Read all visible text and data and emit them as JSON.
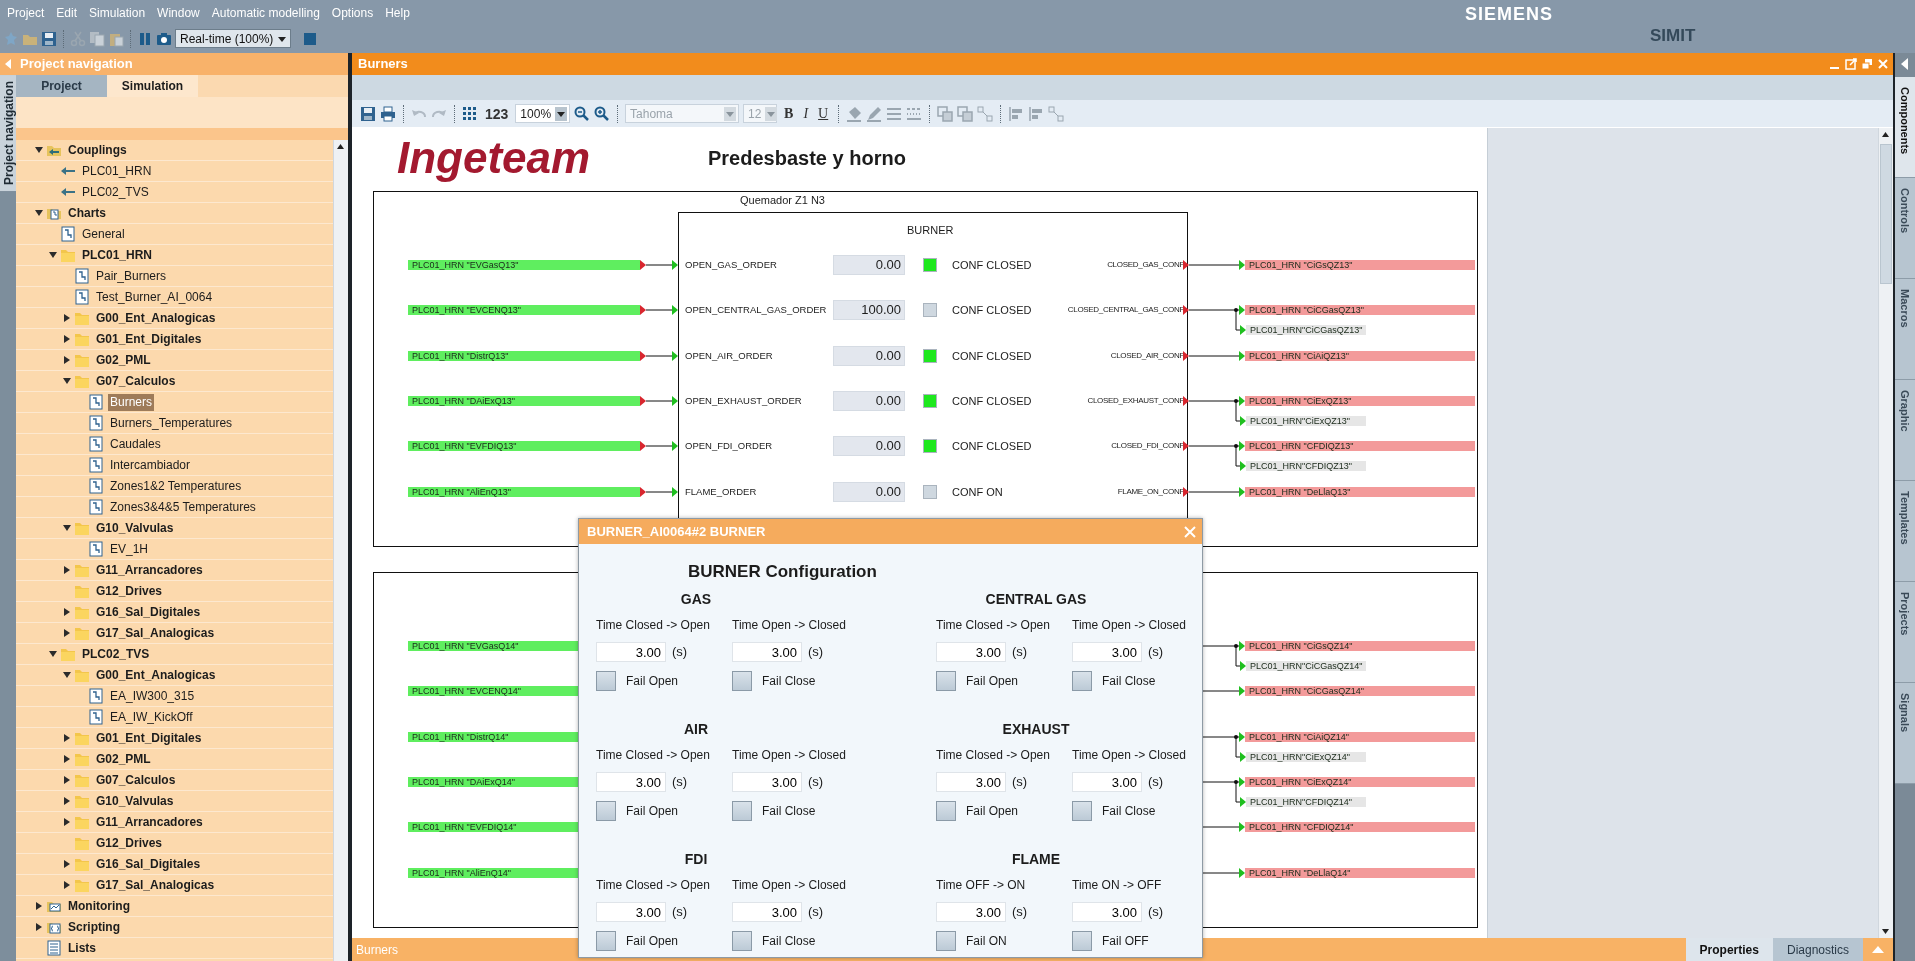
{
  "menu_bar": [
    "Project",
    "Edit",
    "Simulation",
    "Window",
    "Automatic modelling",
    "Options",
    "Help"
  ],
  "toolbar": {
    "speed": "Real-time (100%)"
  },
  "brand": {
    "vendor": "SIEMENS",
    "product": "SIMIT"
  },
  "navigation": {
    "title": "Project navigation",
    "side_label": "Project navigation",
    "tabs": [
      {
        "label": "Project",
        "selected": false
      },
      {
        "label": "Simulation",
        "selected": true
      }
    ],
    "tree": [
      {
        "label": "Couplings",
        "kind": "couplings",
        "expanded": true,
        "selected": false,
        "children": [
          {
            "label": "PLC01_HRN",
            "kind": "coupling",
            "selected": false
          },
          {
            "label": "PLC02_TVS",
            "kind": "coupling",
            "selected": false
          }
        ]
      },
      {
        "label": "Charts",
        "kind": "charts",
        "expanded": true,
        "selected": false,
        "children": [
          {
            "label": "General",
            "kind": "chart",
            "selected": false
          },
          {
            "label": "PLC01_HRN",
            "kind": "folder",
            "expanded": true,
            "selected": false,
            "children": [
              {
                "label": "Pair_Burners",
                "kind": "chart",
                "selected": false
              },
              {
                "label": "Test_Burner_AI_0064",
                "kind": "chart",
                "selected": false
              },
              {
                "label": "G00_Ent_Analogicas",
                "kind": "folder",
                "expanded": false,
                "selected": false
              },
              {
                "label": "G01_Ent_Digitales",
                "kind": "folder",
                "expanded": false,
                "selected": false
              },
              {
                "label": "G02_PML",
                "kind": "folder",
                "expanded": false,
                "selected": false
              },
              {
                "label": "G07_Calculos",
                "kind": "folder",
                "expanded": true,
                "selected": false,
                "children": [
                  {
                    "label": "Burners",
                    "kind": "chart",
                    "selected": true
                  },
                  {
                    "label": "Burners_Temperatures",
                    "kind": "chart",
                    "selected": false
                  },
                  {
                    "label": "Caudales",
                    "kind": "chart",
                    "selected": false
                  },
                  {
                    "label": "Intercambiador",
                    "kind": "chart",
                    "selected": false
                  },
                  {
                    "label": "Zones1&2 Temperatures",
                    "kind": "chart",
                    "selected": false
                  },
                  {
                    "label": "Zones3&4&5 Temperatures",
                    "kind": "chart",
                    "selected": false
                  }
                ]
              },
              {
                "label": "G10_Valvulas",
                "kind": "folder",
                "expanded": true,
                "selected": false,
                "children": [
                  {
                    "label": "EV_1H",
                    "kind": "chart",
                    "selected": false
                  }
                ]
              },
              {
                "label": "G11_Arrancadores",
                "kind": "folder",
                "expanded": false,
                "selected": false
              },
              {
                "label": "G12_Drives",
                "kind": "folder",
                "selected": false
              },
              {
                "label": "G16_Sal_Digitales",
                "kind": "folder",
                "expanded": false,
                "selected": false
              },
              {
                "label": "G17_Sal_Analogicas",
                "kind": "folder",
                "expanded": false,
                "selected": false
              }
            ]
          },
          {
            "label": "PLC02_TVS",
            "kind": "folder",
            "expanded": true,
            "selected": false,
            "children": [
              {
                "label": "G00_Ent_Analogicas",
                "kind": "folder",
                "expanded": true,
                "selected": false,
                "children": [
                  {
                    "label": "EA_IW300_315",
                    "kind": "chart",
                    "selected": false
                  },
                  {
                    "label": "EA_IW_KickOff",
                    "kind": "chart",
                    "selected": false
                  }
                ]
              },
              {
                "label": "G01_Ent_Digitales",
                "kind": "folder",
                "expanded": false,
                "selected": false
              },
              {
                "label": "G02_PML",
                "kind": "folder",
                "expanded": false,
                "selected": false
              },
              {
                "label": "G07_Calculos",
                "kind": "folder",
                "expanded": false,
                "selected": false
              },
              {
                "label": "G10_Valvulas",
                "kind": "folder",
                "expanded": false,
                "selected": false
              },
              {
                "label": "G11_Arrancadores",
                "kind": "folder",
                "expanded": false,
                "selected": false
              },
              {
                "label": "G12_Drives",
                "kind": "folder",
                "selected": false
              },
              {
                "label": "G16_Sal_Digitales",
                "kind": "folder",
                "expanded": false,
                "selected": false
              },
              {
                "label": "G17_Sal_Analogicas",
                "kind": "folder",
                "expanded": false,
                "selected": false
              }
            ]
          }
        ]
      },
      {
        "label": "Monitoring",
        "kind": "monitoring",
        "expanded": false,
        "selected": false
      },
      {
        "label": "Scripting",
        "kind": "scripting",
        "expanded": false,
        "selected": false
      },
      {
        "label": "Lists",
        "kind": "lists",
        "selected": false
      }
    ]
  },
  "editor": {
    "title": "Burners",
    "toolbar": {
      "number_format": "123",
      "zoom": "100%",
      "font": {
        "value": "Tahoma",
        "disabled": true
      },
      "font_size": {
        "value": "12",
        "disabled": true
      },
      "styles": [
        {
          "label": "B",
          "kind": "bold"
        },
        {
          "label": "I",
          "kind": "italic"
        },
        {
          "label": "U",
          "kind": "underline"
        }
      ]
    },
    "chart": {
      "logo": "Ingeteam",
      "title": "Predesbaste y horno",
      "blocks": [
        {
          "group_label": "Quemador Z1 N3",
          "title": "BURNER",
          "rows": [
            {
              "input_signal": "PLC01_HRN \"EVGasQ13\"",
              "input_port": "OPEN_GAS_ORDER",
              "value": "0.00",
              "on": true,
              "status": "CONF CLOSED",
              "output_port": "CLOSED_GAS_CONF",
              "outputs": [
                {
                  "signal": "PLC01_HRN \"CiGsQZ13\"",
                  "kind": "primary"
                }
              ]
            },
            {
              "input_signal": "PLC01_HRN \"EVCENQ13\"",
              "input_port": "OPEN_CENTRAL_GAS_ORDER",
              "value": "100.00",
              "on": false,
              "status": "CONF CLOSED",
              "output_port": "CLOSED_CENTRAL_GAS_CONF",
              "outputs": [
                {
                  "signal": "PLC01_HRN \"CiCGasQZ13\"",
                  "kind": "primary"
                },
                {
                  "signal": "PLC01_HRN\"CiCGasQZ13\"",
                  "kind": "secondary"
                }
              ]
            },
            {
              "input_signal": "PLC01_HRN \"DistrQ13\"",
              "input_port": "OPEN_AIR_ORDER",
              "value": "0.00",
              "on": true,
              "status": "CONF CLOSED",
              "output_port": "CLOSED_AIR_CONF",
              "outputs": [
                {
                  "signal": "PLC01_HRN \"CiAiQZ13\"",
                  "kind": "primary"
                }
              ]
            },
            {
              "input_signal": "PLC01_HRN \"DAiExQ13\"",
              "input_port": "OPEN_EXHAUST_ORDER",
              "value": "0.00",
              "on": true,
              "status": "CONF CLOSED",
              "output_port": "CLOSED_EXHAUST_CONF",
              "outputs": [
                {
                  "signal": "PLC01_HRN \"CiExQZ13\"",
                  "kind": "primary"
                },
                {
                  "signal": "PLC01_HRN\"CiExQZ13\"",
                  "kind": "secondary"
                }
              ]
            },
            {
              "input_signal": "PLC01_HRN \"EVFDIQ13\"",
              "input_port": "OPEN_FDI_ORDER",
              "value": "0.00",
              "on": true,
              "status": "CONF CLOSED",
              "output_port": "CLOSED_FDI_CONF",
              "outputs": [
                {
                  "signal": "PLC01_HRN \"CFDIQZ13\"",
                  "kind": "primary"
                },
                {
                  "signal": "PLC01_HRN\"CFDIQZ13\"",
                  "kind": "secondary"
                }
              ]
            },
            {
              "input_signal": "PLC01_HRN \"AliEnQ13\"",
              "input_port": "FLAME_ORDER",
              "value": "0.00",
              "on": false,
              "status": "CONF ON",
              "output_port": "FLAME_ON_CONF",
              "outputs": [
                {
                  "signal": "PLC01_HRN \"DeLlaQ13\"",
                  "kind": "primary"
                }
              ]
            }
          ]
        },
        {
          "rows": [
            {
              "input_signal": "PLC01_HRN \"EVGasQ14\"",
              "outputs": [
                {
                  "signal": "PLC01_HRN \"CiGsQZ14\"",
                  "kind": "primary"
                },
                {
                  "signal": "PLC01_HRN\"CiCGasQZ14\"",
                  "kind": "secondary"
                }
              ]
            },
            {
              "input_signal": "PLC01_HRN \"EVCENQ14\"",
              "outputs": [
                {
                  "signal": "PLC01_HRN \"CiCGasQZ14\"",
                  "kind": "primary"
                }
              ]
            },
            {
              "input_signal": "PLC01_HRN \"DistrQ14\"",
              "outputs": [
                {
                  "signal": "PLC01_HRN \"CiAiQZ14\"",
                  "kind": "primary"
                },
                {
                  "signal": "PLC01_HRN\"CiExQZ14\"",
                  "kind": "secondary"
                }
              ]
            },
            {
              "input_signal": "PLC01_HRN \"DAiExQ14\"",
              "outputs": [
                {
                  "signal": "PLC01_HRN \"CiExQZ14\"",
                  "kind": "primary"
                },
                {
                  "signal": "PLC01_HRN\"CFDIQZ14\"",
                  "kind": "secondary"
                }
              ]
            },
            {
              "input_signal": "PLC01_HRN \"EVFDIQ14\"",
              "outputs": [
                {
                  "signal": "PLC01_HRN \"CFDIQZ14\"",
                  "kind": "primary"
                }
              ]
            },
            {
              "input_signal": "PLC01_HRN \"AliEnQ14\"",
              "outputs": [
                {
                  "signal": "PLC01_HRN \"DeLlaQ14\"",
                  "kind": "primary"
                }
              ]
            }
          ]
        }
      ]
    },
    "footer_label": "Burners",
    "bottom_tabs": [
      {
        "label": "Properties",
        "selected": true
      },
      {
        "label": "Diagnostics",
        "selected": false
      }
    ]
  },
  "side_tabs": [
    {
      "label": "Components",
      "selected": true
    },
    {
      "label": "Controls",
      "selected": false
    },
    {
      "label": "Macros",
      "selected": false
    },
    {
      "label": "Graphic",
      "selected": false
    },
    {
      "label": "Templates",
      "selected": false
    },
    {
      "label": "Projects",
      "selected": false
    },
    {
      "label": "Signals",
      "selected": false
    }
  ],
  "dialog": {
    "title": "BURNER_AI0064#2 BURNER",
    "heading": "BURNER Configuration",
    "sections": [
      {
        "title": "GAS",
        "timers": [
          {
            "label": "Time Closed -> Open",
            "value": "3.00",
            "unit": "(s)",
            "option": "Fail Open",
            "checked": false
          },
          {
            "label": "Time Open -> Closed",
            "value": "3.00",
            "unit": "(s)",
            "option": "Fail Close",
            "checked": false
          }
        ]
      },
      {
        "title": "CENTRAL GAS",
        "timers": [
          {
            "label": "Time Closed -> Open",
            "value": "3.00",
            "unit": "(s)",
            "option": "Fail Open",
            "checked": false
          },
          {
            "label": "Time Open -> Closed",
            "value": "3.00",
            "unit": "(s)",
            "option": "Fail Close",
            "checked": false
          }
        ]
      },
      {
        "title": "AIR",
        "timers": [
          {
            "label": "Time Closed -> Open",
            "value": "3.00",
            "unit": "(s)",
            "option": "Fail Open",
            "checked": false
          },
          {
            "label": "Time Open -> Closed",
            "value": "3.00",
            "unit": "(s)",
            "option": "Fail Close",
            "checked": false
          }
        ]
      },
      {
        "title": "EXHAUST",
        "timers": [
          {
            "label": "Time Closed -> Open",
            "value": "3.00",
            "unit": "(s)",
            "option": "Fail Open",
            "checked": false
          },
          {
            "label": "Time Open -> Closed",
            "value": "3.00",
            "unit": "(s)",
            "option": "Fail Close",
            "checked": false
          }
        ]
      },
      {
        "title": "FDI",
        "timers": [
          {
            "label": "Time Closed -> Open",
            "value": "3.00",
            "unit": "(s)",
            "option": "Fail Open",
            "checked": false
          },
          {
            "label": "Time Open -> Closed",
            "value": "3.00",
            "unit": "(s)",
            "option": "Fail Close",
            "checked": false
          }
        ]
      },
      {
        "title": "FLAME",
        "timers": [
          {
            "label": "Time OFF -> ON",
            "value": "3.00",
            "unit": "(s)",
            "option": "Fail ON",
            "checked": false
          },
          {
            "label": "Time ON -> OFF",
            "value": "3.00",
            "unit": "(s)",
            "option": "Fail OFF",
            "checked": false
          }
        ]
      }
    ]
  }
}
